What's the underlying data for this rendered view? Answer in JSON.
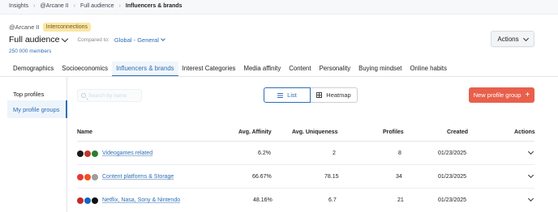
{
  "breadcrumb": [
    "Insights",
    "@Arcane II",
    "Full audience",
    "Influencers & brands"
  ],
  "header": {
    "brand": "@Arcane II",
    "badge": "Interconnections",
    "audience": "Full audience",
    "compared_label": "Compared to:",
    "compared_value": "Global - General",
    "members": "250 000 members",
    "actions_label": "Actions"
  },
  "tabs": [
    "Demographics",
    "Socioeconomics",
    "Influencers & brands",
    "Interest Categories",
    "Media affinity",
    "Content",
    "Personality",
    "Buying mindset",
    "Online habits"
  ],
  "active_tab": "Influencers & brands",
  "sidebar": {
    "items": [
      "Top profiles",
      "My profile groups"
    ]
  },
  "toolbar": {
    "search_placeholder": "Search by name",
    "list_label": "List",
    "heatmap_label": "Heatmap",
    "new_group_label": "New profile group"
  },
  "table": {
    "columns": [
      "Name",
      "Avg. Affinity",
      "Avg. Uniqueness",
      "Profiles",
      "Created",
      "Actions"
    ],
    "rows": [
      {
        "name": "Videogames related",
        "affinity": "6.2%",
        "uniqueness": "2",
        "profiles": "8",
        "created": "01/23/2025",
        "logos": [
          "#1a1a1a",
          "#c0392b",
          "#2e7d32"
        ]
      },
      {
        "name": "Content platforms & Storage",
        "affinity": "66.67%",
        "uniqueness": "78.15",
        "profiles": "34",
        "created": "01/23/2025",
        "logos": [
          "#e53935",
          "#f4511e",
          "#9e9e9e"
        ]
      },
      {
        "name": "Netflix, Nasa, Sony & Nintendo",
        "affinity": "48.16%",
        "uniqueness": "6.7",
        "profiles": "21",
        "created": "01/23/2025",
        "logos": [
          "#c62828",
          "#1565c0",
          "#111111"
        ]
      }
    ]
  },
  "colors": {
    "accent": "#2d6fb5",
    "cta": "#e8604c",
    "badge": "#fbe6a5"
  }
}
